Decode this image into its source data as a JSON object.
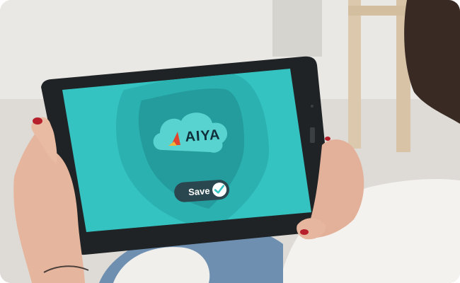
{
  "screen": {
    "logo_text": "AIYA",
    "save_label": "Save",
    "save_checked": true,
    "colors": {
      "screen_bg": "#34c3c1",
      "shield_outer": "#2bb1b0",
      "shield_inner": "#249c9d",
      "cloud": "#58d3d0",
      "logo_text": "#0f2f3a",
      "logo_mark_red": "#e2452f",
      "logo_mark_yellow": "#f2b43a",
      "toggle_bg": "#2a4750",
      "check_circle": "#ffffff",
      "check_mark": "#34c3c1"
    }
  },
  "icons": {
    "logo": "aiya-logo-mark",
    "shield": "shield-icon",
    "cloud": "cloud-icon",
    "check": "check-circle-icon"
  }
}
